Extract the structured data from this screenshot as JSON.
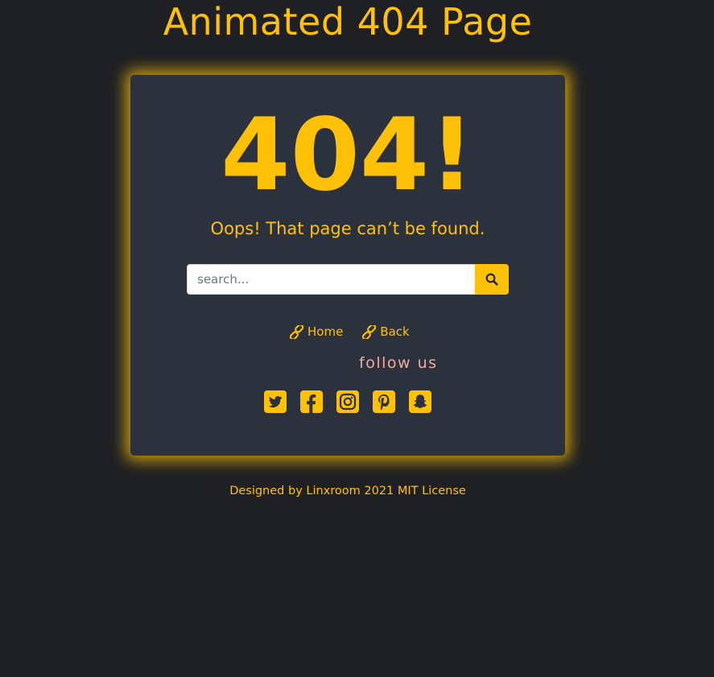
{
  "header": {
    "title": "Animated 404 Page"
  },
  "card": {
    "error_code": "404!",
    "message": "Oops! That page can’t be found.",
    "search": {
      "placeholder": "search...",
      "value": "",
      "button_icon": "search-icon"
    },
    "nav": [
      {
        "label": "Home",
        "icon": "link-icon"
      },
      {
        "label": "Back",
        "icon": "link-icon"
      }
    ],
    "follow_label": "follow us",
    "social": [
      {
        "name": "twitter-icon"
      },
      {
        "name": "facebook-icon"
      },
      {
        "name": "instagram-icon"
      },
      {
        "name": "pinterest-icon"
      },
      {
        "name": "snapchat-icon"
      }
    ]
  },
  "footer": {
    "credit": "Designed by Linxroom 2021 MIT License"
  },
  "colors": {
    "background": "#1f2023",
    "card": "#2c323d",
    "accent": "#ffc107",
    "follow": "#f4a99a"
  }
}
